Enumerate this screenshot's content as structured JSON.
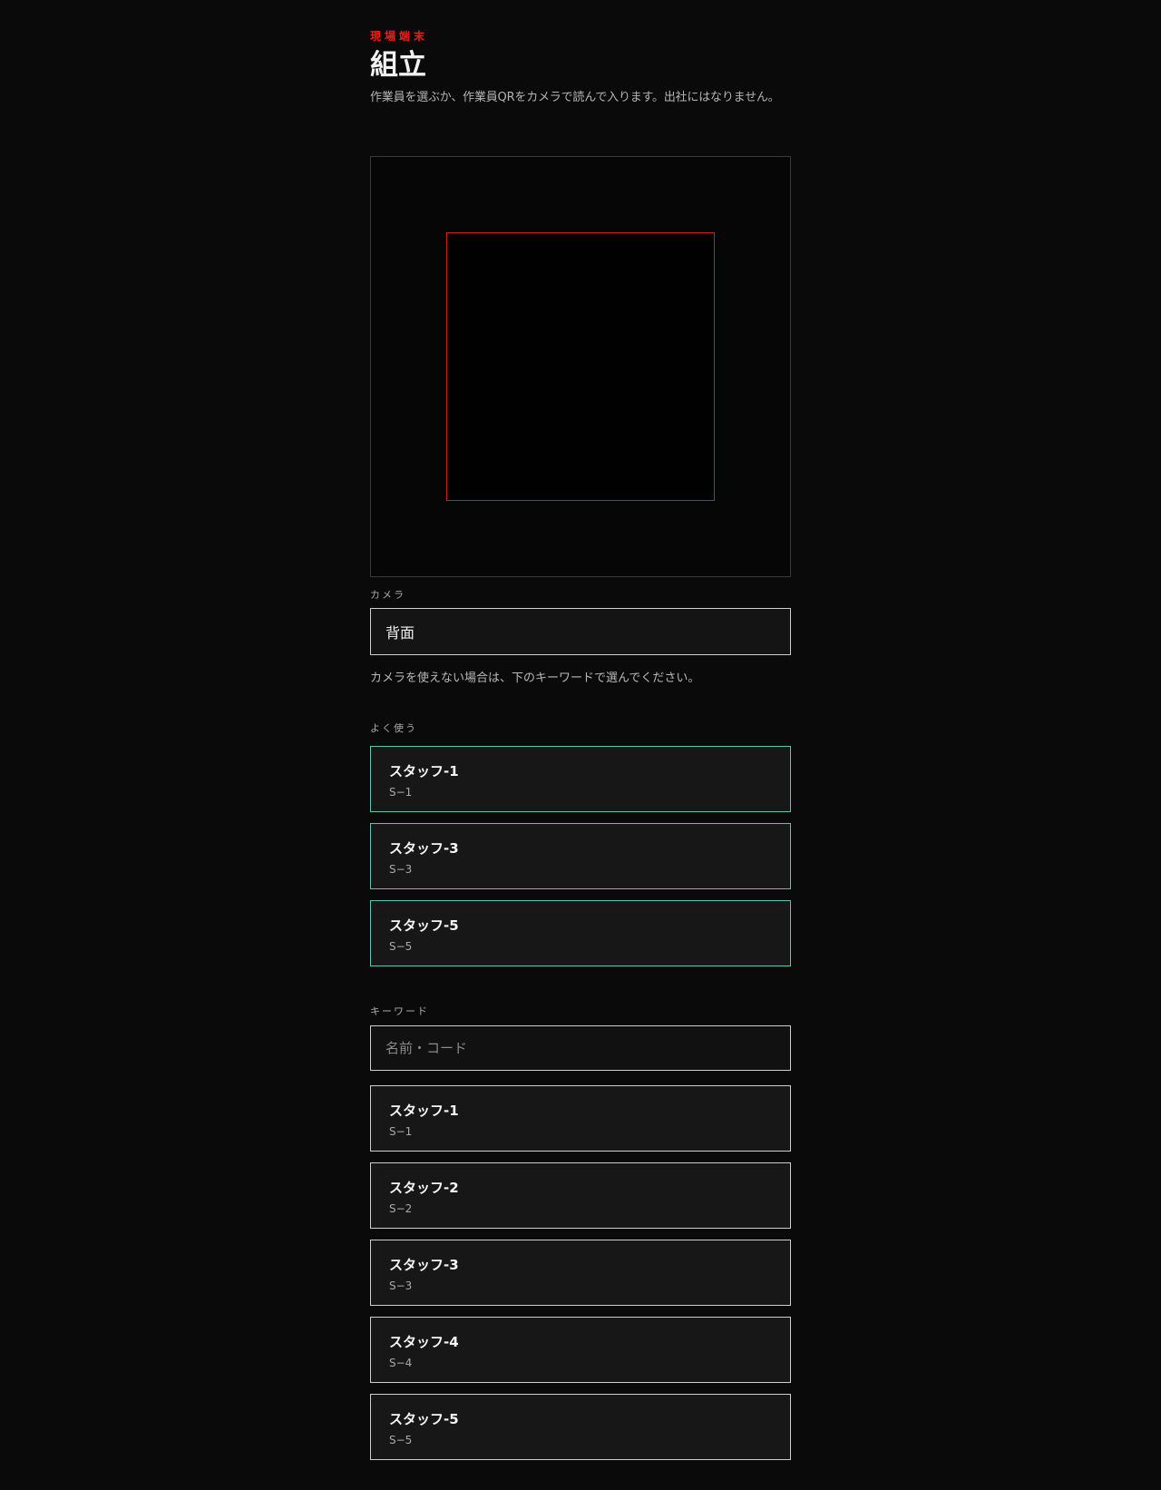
{
  "header": {
    "eyebrow": "現場端末",
    "title": "組立",
    "subtitle": "作業員を選ぶか、作業員QRをカメラで読んで入ります。出社にはなりません。"
  },
  "camera": {
    "label": "カメラ",
    "selected": "背面",
    "fallback_note": "カメラを使えない場合は、下のキーワードで選んでください。"
  },
  "favorites": {
    "label": "よく使う",
    "items": [
      {
        "name": "スタッフ-1",
        "code": "S−1"
      },
      {
        "name": "スタッフ-3",
        "code": "S−3"
      },
      {
        "name": "スタッフ-5",
        "code": "S−5"
      }
    ]
  },
  "keyword": {
    "label": "キーワード",
    "placeholder": "名前・コード",
    "value": ""
  },
  "staff_list": {
    "items": [
      {
        "name": "スタッフ-1",
        "code": "S−1"
      },
      {
        "name": "スタッフ-2",
        "code": "S−2"
      },
      {
        "name": "スタッフ-3",
        "code": "S−3"
      },
      {
        "name": "スタッフ-4",
        "code": "S−4"
      },
      {
        "name": "スタッフ-5",
        "code": "S−5"
      }
    ]
  },
  "colors": {
    "accent": "#e5221c",
    "favorite_border": "#62c3b0",
    "background": "#0a0a0a"
  }
}
